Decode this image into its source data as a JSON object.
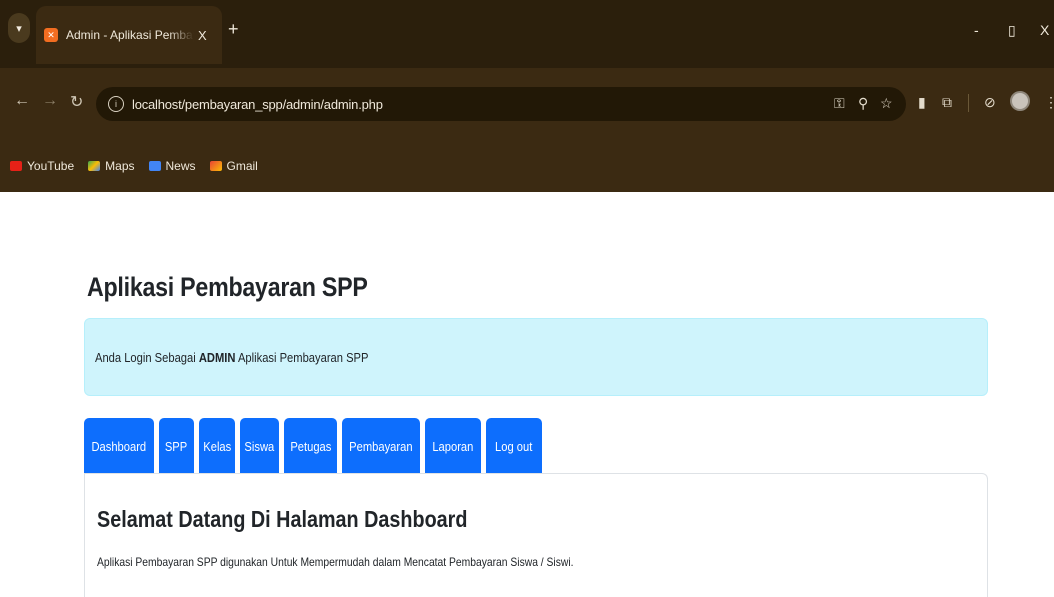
{
  "browser": {
    "tab_title": "Admin - Aplikasi Pembayaran S",
    "tab_close": "X",
    "new_tab": "+",
    "url": "localhost/pembayaran_spp/admin/admin.php",
    "window_controls": {
      "minimize": "-",
      "restore": "▯",
      "close": "X"
    },
    "icons": [
      "key-icon",
      "zoom-icon",
      "star-icon",
      "extension-icon",
      "puzzle-icon",
      "sync-icon",
      "profile-avatar",
      "menu-icon"
    ],
    "bookmarks": [
      {
        "label": "YouTube",
        "color": "#e62117"
      },
      {
        "label": "Maps",
        "color": "#34a853"
      },
      {
        "label": "News",
        "color": "#4285f4"
      },
      {
        "label": "Gmail",
        "color": "#ea4335"
      }
    ]
  },
  "page": {
    "title": "Aplikasi Pembayaran SPP",
    "alert": {
      "prefix": "Anda Login Sebagai",
      "role": "ADMIN",
      "suffix": "Aplikasi Pembayaran SPP"
    },
    "nav": [
      {
        "label": "Dashboard"
      },
      {
        "label": "SPP"
      },
      {
        "label": "Kelas"
      },
      {
        "label": "Siswa"
      },
      {
        "label": "Petugas"
      },
      {
        "label": "Pembayaran"
      },
      {
        "label": "Laporan"
      },
      {
        "label": "Log out"
      }
    ],
    "card": {
      "heading": "Selamat Datang Di Halaman Dashboard",
      "text": "Aplikasi Pembayaran SPP digunakan Untuk Mempermudah dalam Mencatat Pembayaran Siswa / Siswi."
    }
  },
  "colors": {
    "primary": "#0d6efd",
    "alert_bg": "#cff4fc",
    "chrome_bg": "#3b2a12"
  }
}
